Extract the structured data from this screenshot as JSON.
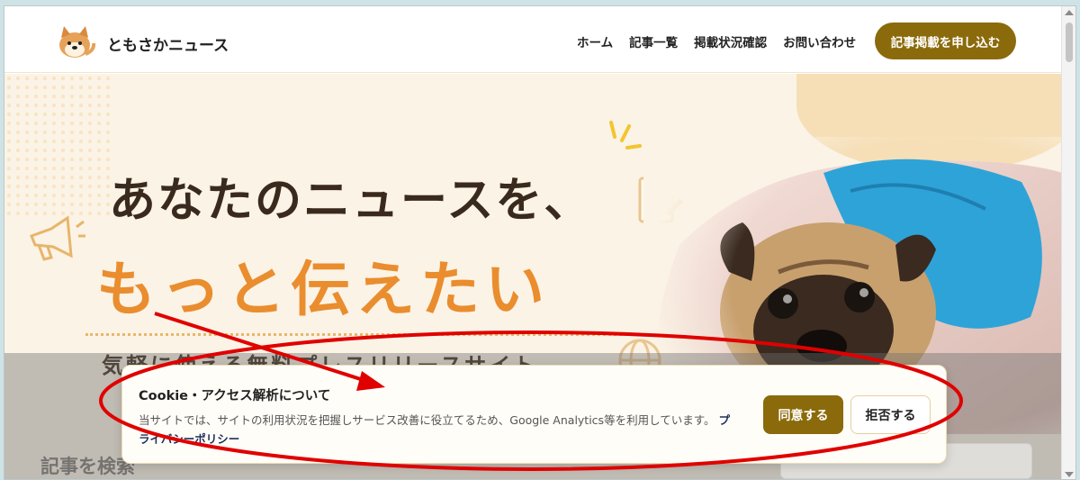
{
  "header": {
    "site_name": "ともさかニュース",
    "nav": [
      "ホーム",
      "記事一覧",
      "掲載状況確認",
      "お問い合わせ"
    ],
    "cta": "記事掲載を申し込む"
  },
  "hero": {
    "line1": "あなたのニュースを、",
    "line2": "もっと伝えたい",
    "sub": "気軽に使える無料プレスリリースサイト"
  },
  "search": {
    "title": "記事を検索"
  },
  "cookie": {
    "title": "Cookie・アクセス解析について",
    "text": "当サイトでは、サイトの利用状況を把握しサービス改善に役立てるため、Google Analytics等を利用しています。",
    "link": "プライバシーポリシー",
    "agree": "同意する",
    "reject": "拒否する"
  },
  "colors": {
    "brand": "#8b6a0b",
    "accent_orange": "#ea8d2e",
    "annotation_red": "#e00000"
  },
  "icons": [
    "dog-logo-icon",
    "megaphone-icon",
    "document-icon",
    "globe-icon"
  ]
}
